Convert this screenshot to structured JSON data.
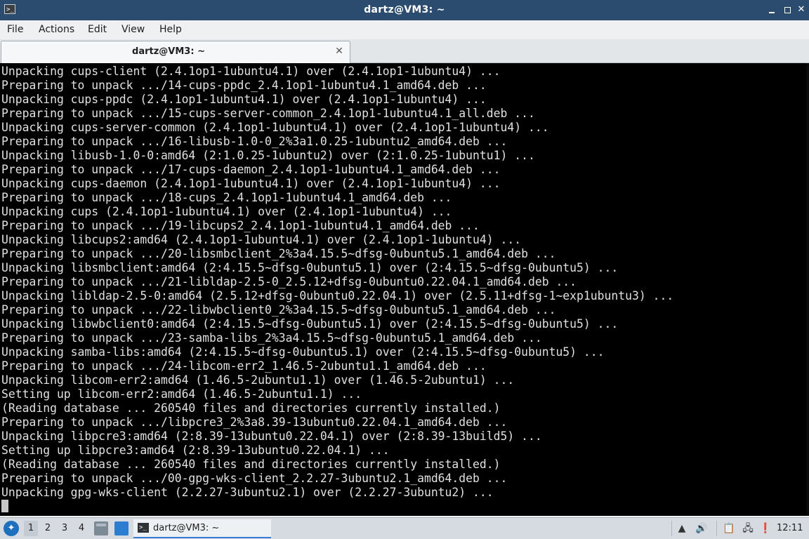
{
  "window": {
    "title": "dartz@VM3: ~",
    "app_icon": "terminal-icon",
    "controls": {
      "minimize": "minimize-icon",
      "maximize": "maximize-icon",
      "close": "✕"
    }
  },
  "menubar": {
    "items": [
      "File",
      "Actions",
      "Edit",
      "View",
      "Help"
    ]
  },
  "tabs": [
    {
      "label": "dartz@VM3: ~",
      "close": "✕"
    }
  ],
  "terminal": {
    "lines": [
      "Unpacking cups-client (2.4.1op1-1ubuntu4.1) over (2.4.1op1-1ubuntu4) ...",
      "Preparing to unpack .../14-cups-ppdc_2.4.1op1-1ubuntu4.1_amd64.deb ...",
      "Unpacking cups-ppdc (2.4.1op1-1ubuntu4.1) over (2.4.1op1-1ubuntu4) ...",
      "Preparing to unpack .../15-cups-server-common_2.4.1op1-1ubuntu4.1_all.deb ...",
      "Unpacking cups-server-common (2.4.1op1-1ubuntu4.1) over (2.4.1op1-1ubuntu4) ...",
      "Preparing to unpack .../16-libusb-1.0-0_2%3a1.0.25-1ubuntu2_amd64.deb ...",
      "Unpacking libusb-1.0-0:amd64 (2:1.0.25-1ubuntu2) over (2:1.0.25-1ubuntu1) ...",
      "Preparing to unpack .../17-cups-daemon_2.4.1op1-1ubuntu4.1_amd64.deb ...",
      "Unpacking cups-daemon (2.4.1op1-1ubuntu4.1) over (2.4.1op1-1ubuntu4) ...",
      "Preparing to unpack .../18-cups_2.4.1op1-1ubuntu4.1_amd64.deb ...",
      "Unpacking cups (2.4.1op1-1ubuntu4.1) over (2.4.1op1-1ubuntu4) ...",
      "Preparing to unpack .../19-libcups2_2.4.1op1-1ubuntu4.1_amd64.deb ...",
      "Unpacking libcups2:amd64 (2.4.1op1-1ubuntu4.1) over (2.4.1op1-1ubuntu4) ...",
      "Preparing to unpack .../20-libsmbclient_2%3a4.15.5~dfsg-0ubuntu5.1_amd64.deb ...",
      "Unpacking libsmbclient:amd64 (2:4.15.5~dfsg-0ubuntu5.1) over (2:4.15.5~dfsg-0ubuntu5) ...",
      "Preparing to unpack .../21-libldap-2.5-0_2.5.12+dfsg-0ubuntu0.22.04.1_amd64.deb ...",
      "Unpacking libldap-2.5-0:amd64 (2.5.12+dfsg-0ubuntu0.22.04.1) over (2.5.11+dfsg-1~exp1ubuntu3) ...",
      "Preparing to unpack .../22-libwbclient0_2%3a4.15.5~dfsg-0ubuntu5.1_amd64.deb ...",
      "Unpacking libwbclient0:amd64 (2:4.15.5~dfsg-0ubuntu5.1) over (2:4.15.5~dfsg-0ubuntu5) ...",
      "Preparing to unpack .../23-samba-libs_2%3a4.15.5~dfsg-0ubuntu5.1_amd64.deb ...",
      "Unpacking samba-libs:amd64 (2:4.15.5~dfsg-0ubuntu5.1) over (2:4.15.5~dfsg-0ubuntu5) ...",
      "Preparing to unpack .../24-libcom-err2_1.46.5-2ubuntu1.1_amd64.deb ...",
      "Unpacking libcom-err2:amd64 (1.46.5-2ubuntu1.1) over (1.46.5-2ubuntu1) ...",
      "Setting up libcom-err2:amd64 (1.46.5-2ubuntu1.1) ...",
      "(Reading database ... 260540 files and directories currently installed.)",
      "Preparing to unpack .../libpcre3_2%3a8.39-13ubuntu0.22.04.1_amd64.deb ...",
      "Unpacking libpcre3:amd64 (2:8.39-13ubuntu0.22.04.1) over (2:8.39-13build5) ...",
      "Setting up libpcre3:amd64 (2:8.39-13ubuntu0.22.04.1) ...",
      "(Reading database ... 260540 files and directories currently installed.)",
      "Preparing to unpack .../00-gpg-wks-client_2.2.27-3ubuntu2.1_amd64.deb ...",
      "Unpacking gpg-wks-client (2.2.27-3ubuntu2.1) over (2.2.27-3ubuntu2) ..."
    ]
  },
  "taskbar": {
    "start_icon": "start-menu-icon",
    "workspaces": [
      "1",
      "2",
      "3",
      "4"
    ],
    "active_workspace": "1",
    "launchers": [
      "file-manager-icon",
      "show-desktop-icon"
    ],
    "tasks": [
      {
        "label": "dartz@VM3: ~",
        "icon": "terminal-icon"
      }
    ],
    "tray": [
      "up-arrow-icon",
      "volume-icon",
      "clipboard-icon",
      "network-icon",
      "notification-icon"
    ],
    "clock": "12:11"
  },
  "colors": {
    "titlebar": "#2b4c6f",
    "terminal_bg": "#000000",
    "terminal_fg": "#e0e0e0",
    "taskbar": "#d6dbe1"
  }
}
